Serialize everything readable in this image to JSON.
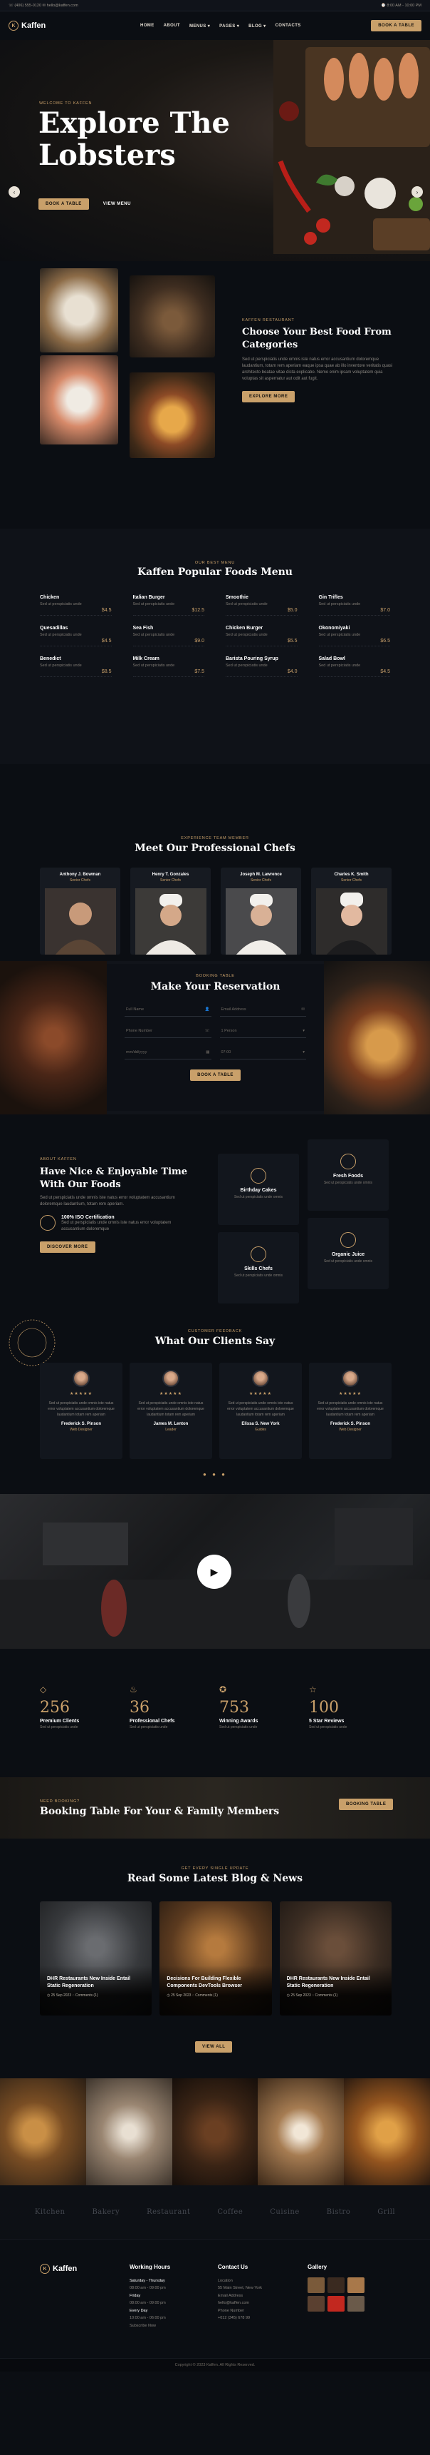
{
  "topbar": {
    "left": "☏ (406) 555-0120   ✉ hello@kaffen.com",
    "right": "⌚ 8:00 AM - 10:00 PM"
  },
  "nav": {
    "brand": "Kaffen",
    "items": [
      "HOME",
      "ABOUT",
      "MENUS ▾",
      "PAGES ▾",
      "BLOG ▾",
      "CONTACTS"
    ],
    "cta": "BOOK A TABLE"
  },
  "hero": {
    "tag": "WELCOME TO KAFFEN",
    "title_line1": "Explore The",
    "title_line2": "Lobsters",
    "btn_primary": "BOOK A TABLE",
    "btn_secondary": "VIEW MENU"
  },
  "about": {
    "eyebrow": "Kaffen Restaurant",
    "title": "Choose Your Best Food From Categories",
    "text": "Sed ut perspiciatis unde omnis iste natus error accusantium doloremque laudantium, totam rem aperiam eaque ipsa quae ab illo inventore veritatis quasi architecto beatae vitae dicta explicabo. Nemo enim ipsam voluptatem quia voluptas sit aspernatur aut odit aut fugit.",
    "button": "EXPLORE MORE"
  },
  "menu": {
    "eyebrow": "Our best menu",
    "title": "Kaffen Popular Foods Menu",
    "desc": "Sed ut perspiciatis unde",
    "items": [
      {
        "name": "Chicken",
        "price": "$4.5"
      },
      {
        "name": "Italian Burger",
        "price": "$12.5"
      },
      {
        "name": "Smoothie",
        "price": "$5.0"
      },
      {
        "name": "Gin Trifles",
        "price": "$7.0"
      },
      {
        "name": "Quesadillas",
        "price": "$4.5"
      },
      {
        "name": "Sea Fish",
        "price": "$9.0"
      },
      {
        "name": "Chicken Burger",
        "price": "$5.5"
      },
      {
        "name": "Okonomiyaki",
        "price": "$6.5"
      },
      {
        "name": "Benedict",
        "price": "$8.5"
      },
      {
        "name": "Milk Cream",
        "price": "$7.5"
      },
      {
        "name": "Barista Pouring Syrup",
        "price": "$4.0"
      },
      {
        "name": "Salad Bowl",
        "price": "$4.5"
      }
    ]
  },
  "chefs": {
    "eyebrow": "Experience team member",
    "title": "Meet Our Professional Chefs",
    "items": [
      {
        "name": "Anthony J. Bowman",
        "role": "Senior Chefs"
      },
      {
        "name": "Henry T. Gonzales",
        "role": "Senior Chefs"
      },
      {
        "name": "Joseph M. Lawrence",
        "role": "Senior Chefs"
      },
      {
        "name": "Charles K. Smith",
        "role": "Senior Chefs"
      }
    ]
  },
  "reservation": {
    "eyebrow": "Booking table",
    "title": "Make Your Reservation",
    "fields": [
      "Full Name",
      "Email Address",
      "Phone Number",
      "1 Person",
      "mm/dd/yyyy",
      "07:00"
    ],
    "button": "BOOK A TABLE"
  },
  "features": {
    "eyebrow": "About Kaffen",
    "title": "Have Nice & Enjoyable Time With Our Foods",
    "text": "Sed ut perspiciatis unde omnis iste natus error voluptatem accusantium doloremque laudantium, totam rem aperiam.",
    "cert_title": "100% ISO Certification",
    "cert_text": "Sed ut perspiciatis unde omnis iste natus error voluptatem accusantium doloremque",
    "button": "DISCOVER MORE",
    "cards": [
      {
        "title": "Birthday Cakes",
        "desc": "Sed ut perspiciatis unde omnis"
      },
      {
        "title": "Fresh Foods",
        "desc": "Sed ut perspiciatis unde omnis"
      },
      {
        "title": "Skills Chefs",
        "desc": "Sed ut perspiciatis unde omnis"
      },
      {
        "title": "Organic Juice",
        "desc": "Sed ut perspiciatis unde omnis"
      }
    ]
  },
  "testimonials": {
    "eyebrow": "Customer Feedback",
    "title": "What Our Clients Say",
    "stars": "★★★★★",
    "text": "Sed ut perspiciatis unde omnis iste natus error voluptatem accusantium doloremque laudantium totam rem aperiam",
    "items": [
      {
        "name": "Frederick S. Pinson",
        "role": "Web Designer"
      },
      {
        "name": "James M. Lenton",
        "role": "Leader"
      },
      {
        "name": "Elissa S. New York",
        "role": "Guides"
      },
      {
        "name": "Frederick S. Pinson",
        "role": "Web Designer"
      }
    ],
    "dots": "● ● ●"
  },
  "counters": {
    "desc": "Sed ut perspiciatis unde",
    "items": [
      {
        "num": "256",
        "label": "Premium Clients"
      },
      {
        "num": "36",
        "label": "Professional Chefs"
      },
      {
        "num": "753",
        "label": "Winning Awards"
      },
      {
        "num": "100",
        "label": "5 Star Reviews"
      }
    ]
  },
  "booking": {
    "eyebrow": "Need booking?",
    "title": "Booking Table For Your & Family Members",
    "button": "BOOKING TABLE"
  },
  "blog": {
    "eyebrow": "Get every single update",
    "title": "Read Some Latest Blog & News",
    "posts": [
      {
        "title": "DHR Restaurants New Inside Entail Static Regeneration",
        "meta": "◷ 25 Sep 2023   ◌ Comments (1)"
      },
      {
        "title": "Decisions For Building Flexible Components DevTools Browser",
        "meta": "◷ 25 Sep 2023   ◌ Comments (1)"
      },
      {
        "title": "DHR Restaurants New Inside Entail Static Regeneration",
        "meta": "◷ 25 Sep 2023   ◌ Comments (1)"
      }
    ],
    "button": "VIEW ALL"
  },
  "logos": [
    "Kitchen",
    "Bakery",
    "Restaurant",
    "Coffee",
    "Cuisine",
    "Bistro",
    "Grill"
  ],
  "footer": {
    "brand": "Kaffen",
    "hours_title": "Working Hours",
    "hours": [
      "Saturday - Thursday",
      "08:00 am - 09:00 pm",
      "Friday",
      "08:00 am - 09:00 pm",
      "Every Day",
      "10:00 am - 06:00 pm"
    ],
    "hours_link": "Subscribe Now",
    "contact_title": "Contact Us",
    "contact": [
      "Location",
      "55 Main Street, New York",
      "Email Address",
      "hello@kaffen.com",
      "Phone Number",
      "+012 (345) 678 99"
    ],
    "gallery_title": "Gallery"
  },
  "copyright": "Copyright © 2023 Kaffen. All Rights Reserved."
}
